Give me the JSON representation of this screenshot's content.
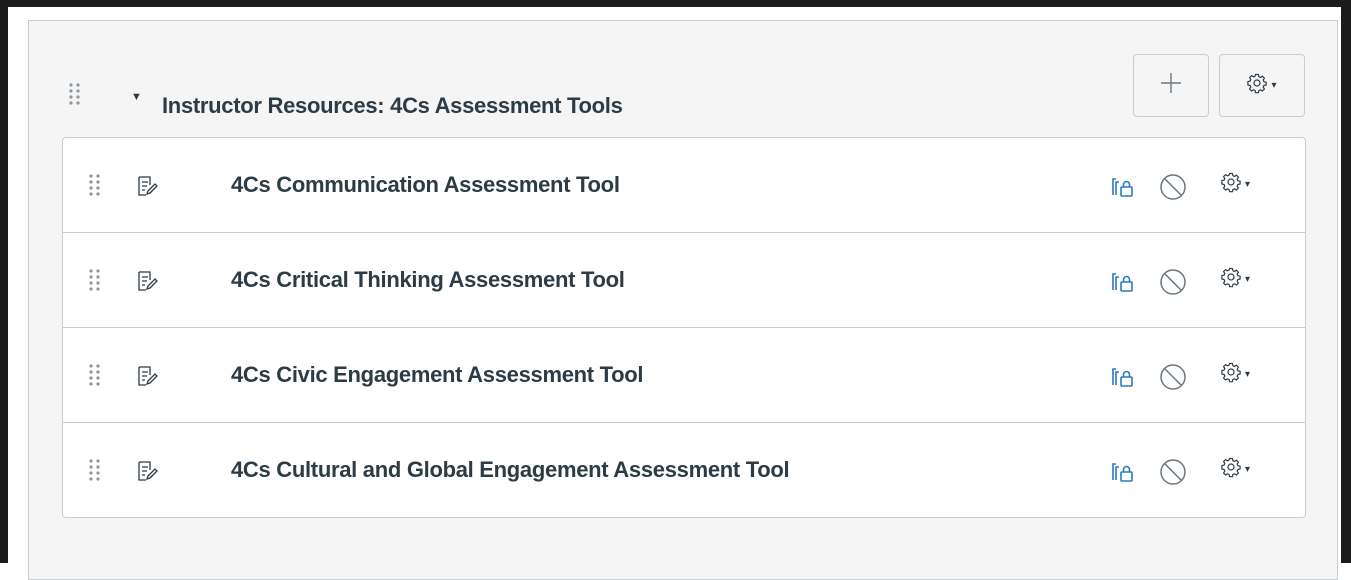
{
  "module": {
    "title": "Instructor Resources: 4Cs Assessment Tools",
    "collapse_icon": "caret-down-icon",
    "add_icon": "plus-icon",
    "settings_icon": "gear-icon",
    "settings_caret": "▾"
  },
  "items": [
    {
      "title": "4Cs Communication Assessment Tool",
      "type_icon": "page-icon",
      "caret": "▾"
    },
    {
      "title": "4Cs Critical Thinking Assessment Tool",
      "type_icon": "page-icon",
      "caret": "▾"
    },
    {
      "title": "4Cs Civic Engagement Assessment Tool",
      "type_icon": "page-icon",
      "caret": "▾"
    },
    {
      "title": "4Cs Cultural and Global Engagement Assessment Tool",
      "type_icon": "page-icon",
      "caret": "▾"
    }
  ],
  "colors": {
    "text": "#2d3b45",
    "accent": "#2b7abc",
    "border": "#c7cdd1",
    "module_bg": "#f5f5f5"
  }
}
